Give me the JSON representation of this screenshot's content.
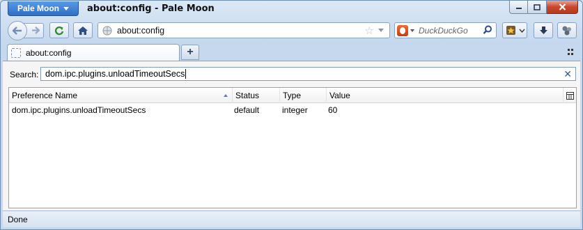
{
  "window": {
    "app_menu_label": "Pale Moon",
    "title": "about:config - Pale Moon"
  },
  "navbar": {
    "url": "about:config",
    "search_engine_placeholder": "DuckDuckGo"
  },
  "tabs": [
    {
      "label": "about:config"
    }
  ],
  "content": {
    "search_label": "Search:",
    "search_value": "dom.ipc.plugins.unloadTimeoutSecs",
    "columns": {
      "name": "Preference Name",
      "status": "Status",
      "type": "Type",
      "value": "Value"
    },
    "rows": [
      {
        "name": "dom.ipc.plugins.unloadTimeoutSecs",
        "status": "default",
        "type": "integer",
        "value": "60"
      }
    ]
  },
  "statusbar": {
    "text": "Done"
  },
  "colors": {
    "app_menu": "#3a7fd5",
    "close_button": "#c9462c",
    "chrome": "#c5d8ee"
  }
}
